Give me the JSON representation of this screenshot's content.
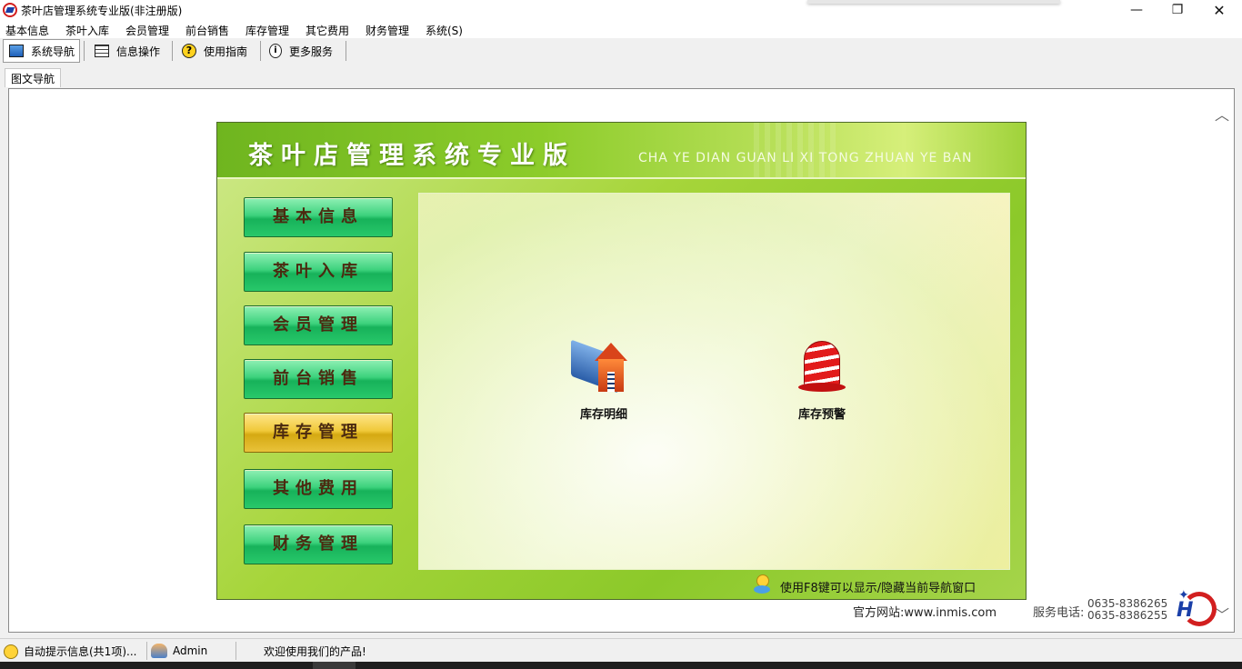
{
  "window": {
    "title": "茶叶店管理系统专业版(非注册版)",
    "minimize_glyph": "—",
    "maximize_glyph": "❐",
    "close_glyph": "✕"
  },
  "menu": [
    {
      "label": "基本信息"
    },
    {
      "label": "茶叶入库"
    },
    {
      "label": "会员管理"
    },
    {
      "label": "前台销售"
    },
    {
      "label": "库存管理"
    },
    {
      "label": "其它费用"
    },
    {
      "label": "财务管理"
    },
    {
      "label": "系统(S)"
    }
  ],
  "toolbar": [
    {
      "label": "系统导航",
      "icon": "monitor-icon",
      "active": true
    },
    {
      "label": "信息操作",
      "icon": "grid-icon",
      "active": false
    },
    {
      "label": "使用指南",
      "icon": "help-icon",
      "active": false
    },
    {
      "label": "更多服务",
      "icon": "info-icon",
      "active": false
    }
  ],
  "tab": {
    "label": "图文导航"
  },
  "nav": {
    "title": "茶叶店管理系统专业版",
    "subtitle": "CHA YE DIAN GUAN LI XI TONG ZHUAN YE BAN",
    "side_buttons": [
      {
        "label": "基本信息",
        "active": false
      },
      {
        "label": "茶叶入库",
        "active": false
      },
      {
        "label": "会员管理",
        "active": false
      },
      {
        "label": "前台销售",
        "active": false
      },
      {
        "label": "库存管理",
        "active": true
      },
      {
        "label": "其他费用",
        "active": false
      },
      {
        "label": "财务管理",
        "active": false
      }
    ],
    "functions": [
      {
        "label": "库存明细",
        "icon": "house-book-icon"
      },
      {
        "label": "库存预警",
        "icon": "alarm-bell-icon"
      }
    ],
    "hint": "使用F8键可以显示/隐藏当前导航窗口"
  },
  "footer": {
    "website": "官方网站:www.inmis.com",
    "phone_label": "服务电话:",
    "phones": [
      "0635-8386265",
      "0635-8386255"
    ],
    "logo_letters": "H"
  },
  "status": {
    "tips": "自动提示信息(共1项)...",
    "user": "Admin",
    "welcome": "欢迎使用我们的产品!"
  },
  "colors": {
    "panel_green": "#8cc92a",
    "button_green": "#28c86a",
    "button_active_gold": "#e8c23a",
    "brand_red": "#d21f1f",
    "brand_blue": "#1a3fa8"
  }
}
